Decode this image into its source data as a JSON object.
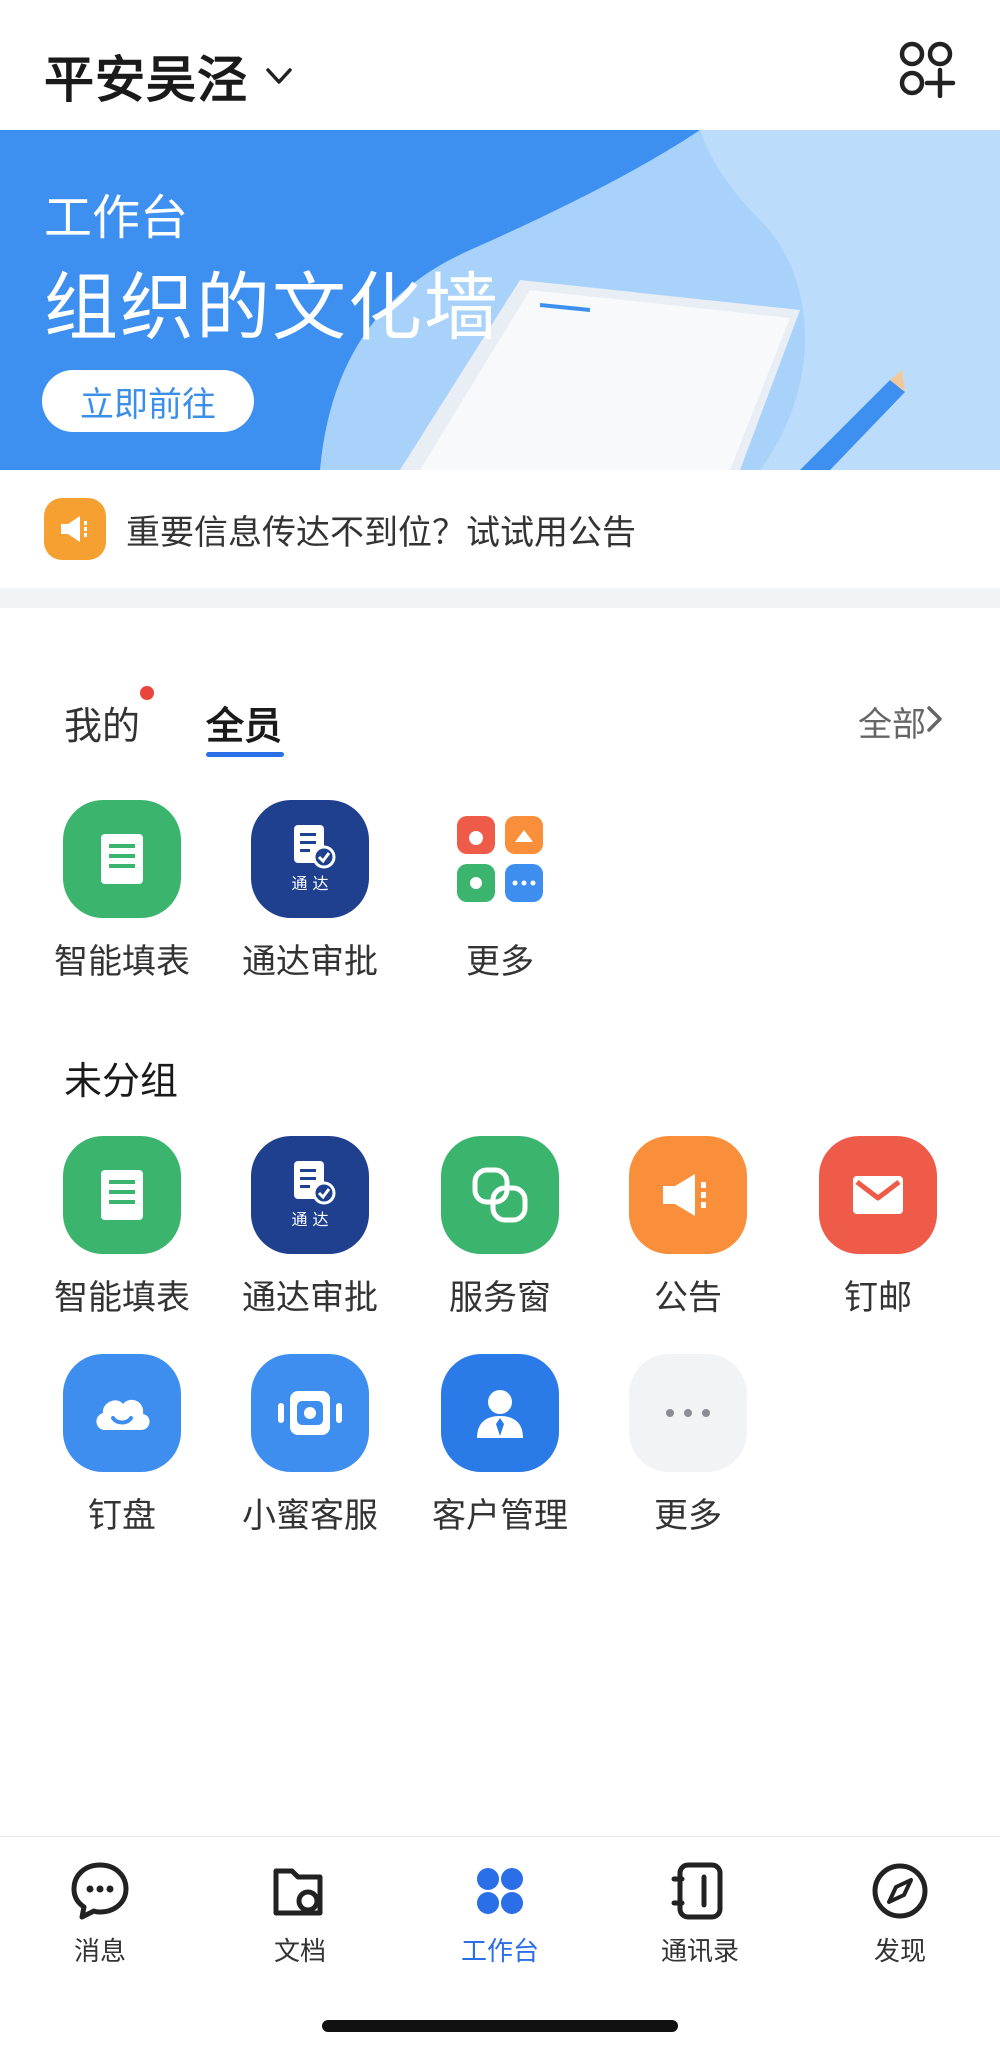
{
  "header": {
    "org_name": "平安吴泾",
    "add_icon": "add-app-icon"
  },
  "banner": {
    "subtitle": "工作台",
    "title": "组织的文化墙",
    "button": "立即前往"
  },
  "notice": {
    "icon": "megaphone-icon",
    "text": "重要信息传达不到位？试试用公告"
  },
  "tabs": {
    "mine": "我的",
    "all": "全员",
    "all_link": "全部"
  },
  "my_apps": [
    {
      "label": "智能填表",
      "icon": "form-icon",
      "color": "#3bb46e"
    },
    {
      "label": "通达审批",
      "icon": "approval-icon",
      "color": "#1f3f8f",
      "badge_text": "通 达"
    },
    {
      "label": "更多",
      "icon": "more-grid-icon",
      "color": "#ffffff"
    }
  ],
  "group": {
    "title": "未分组",
    "apps": [
      {
        "label": "智能填表",
        "icon": "form-icon",
        "color": "#3bb46e"
      },
      {
        "label": "通达审批",
        "icon": "approval-icon",
        "color": "#1f3f8f",
        "badge_text": "通 达"
      },
      {
        "label": "服务窗",
        "icon": "service-window-icon",
        "color": "#3bb46e"
      },
      {
        "label": "公告",
        "icon": "megaphone-icon",
        "color": "#f98f3a"
      },
      {
        "label": "钉邮",
        "icon": "mail-icon",
        "color": "#ee5b48"
      },
      {
        "label": "钉盘",
        "icon": "cloud-icon",
        "color": "#3e8ef0"
      },
      {
        "label": "小蜜客服",
        "icon": "robot-icon",
        "color": "#3e8ef0"
      },
      {
        "label": "客户管理",
        "icon": "customer-icon",
        "color": "#2a7ae8"
      },
      {
        "label": "更多",
        "icon": "more-dots-icon",
        "color": "#f2f3f5"
      }
    ]
  },
  "bottom_nav": [
    {
      "label": "消息",
      "icon": "message-icon",
      "active": false
    },
    {
      "label": "文档",
      "icon": "document-icon",
      "active": false
    },
    {
      "label": "工作台",
      "icon": "workbench-icon",
      "active": true
    },
    {
      "label": "通讯录",
      "icon": "contacts-icon",
      "active": false
    },
    {
      "label": "发现",
      "icon": "compass-icon",
      "active": false
    }
  ],
  "colors": {
    "accent": "#2a6ee8",
    "banner_blue": "#3d8ff0"
  }
}
